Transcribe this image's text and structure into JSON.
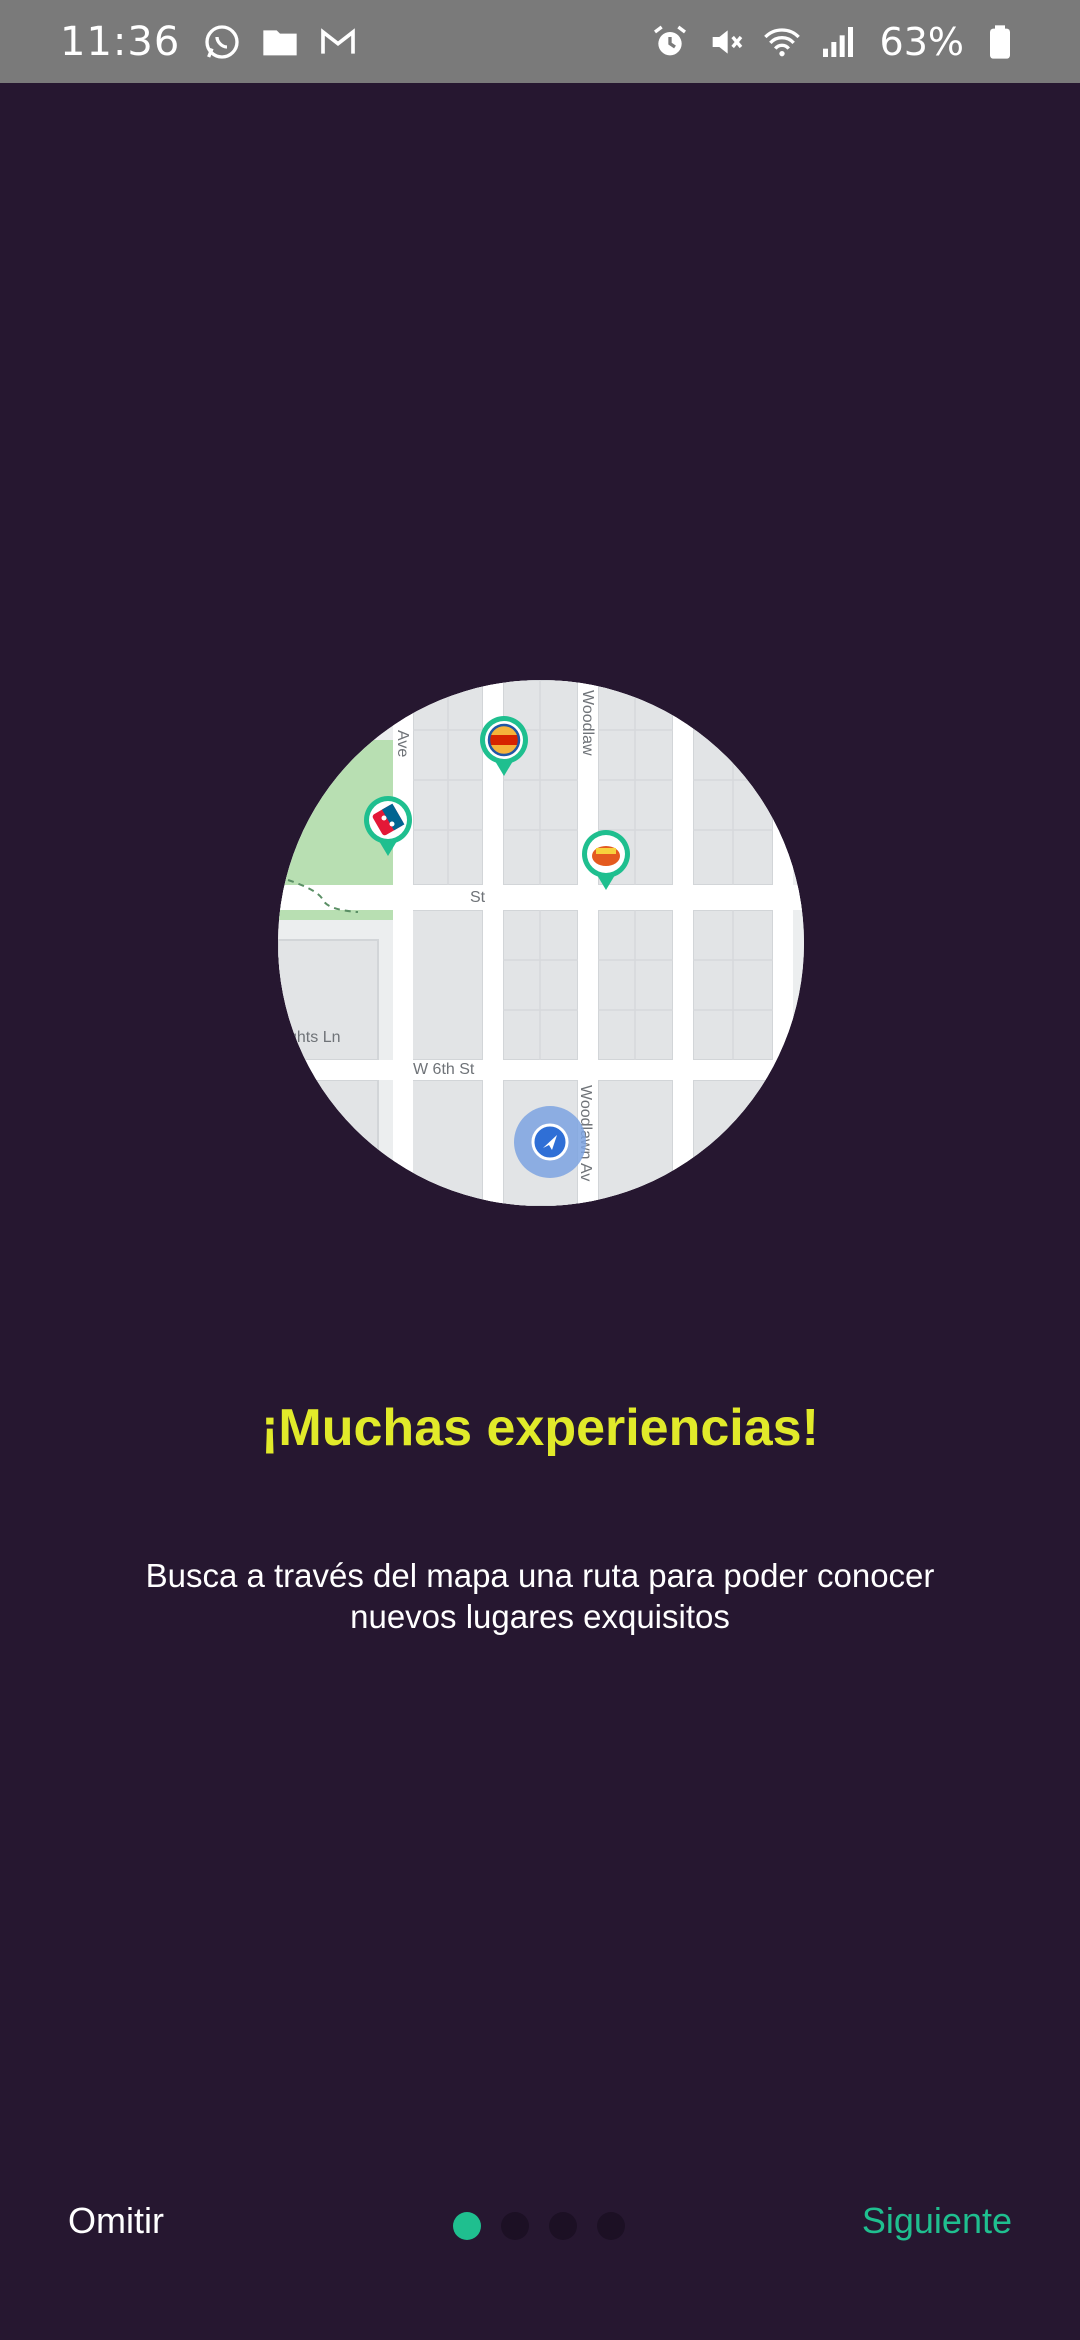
{
  "status_bar": {
    "time": "11:36",
    "battery": "63%",
    "icons_left": [
      "whatsapp-icon",
      "folder-icon",
      "gmail-icon"
    ],
    "icons_right": [
      "alarm-icon",
      "mute-icon",
      "wifi-icon",
      "signal-icon",
      "battery-icon"
    ]
  },
  "illustration": {
    "streets": [
      "Ave",
      "Woodlaw",
      "St",
      "ghts Ln",
      "W 6th St",
      "Woodlawn Av"
    ]
  },
  "onboarding": {
    "title": "¡Muchas experiencias!",
    "description": "Busca a través del mapa una ruta para poder conocer nuevos lugares exquisitos"
  },
  "navigation": {
    "skip_label": "Omitir",
    "next_label": "Siguiente",
    "total_pages": 4,
    "current_page": 1
  },
  "colors": {
    "background": "#261730",
    "title": "#e1ea2a",
    "accent": "#1fbf8f"
  }
}
